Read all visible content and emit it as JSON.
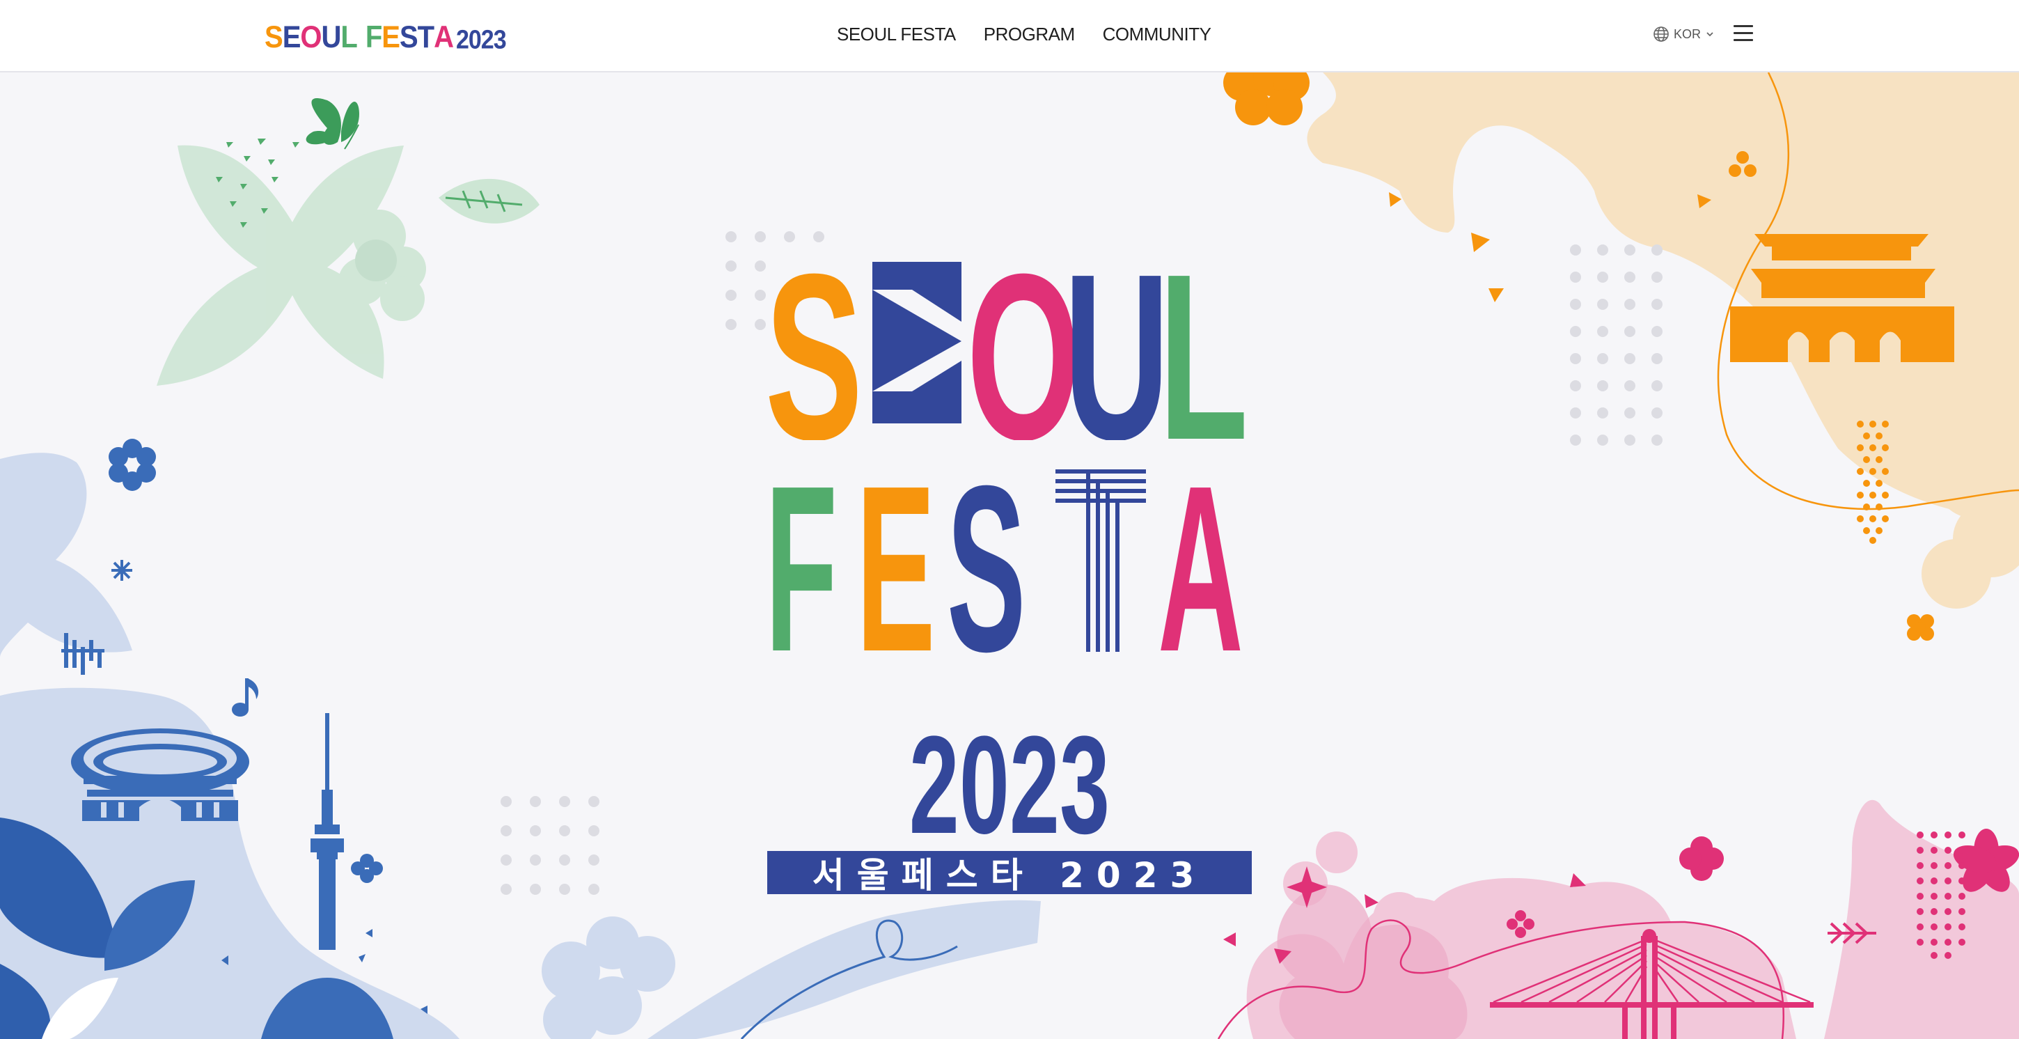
{
  "header": {
    "logo": {
      "word1": "SEOUL",
      "word2": "FESTA",
      "year": "2023"
    },
    "nav": [
      {
        "label": "SEOUL FESTA"
      },
      {
        "label": "PROGRAM"
      },
      {
        "label": "COMMUNITY"
      }
    ],
    "language": {
      "label": "KOR",
      "icon": "globe-icon",
      "caret": "chevron-down-icon"
    },
    "menu_icon": "hamburger-menu-icon"
  },
  "hero": {
    "title_line1": [
      "S",
      "E",
      "O",
      "U",
      "L"
    ],
    "title_line2": [
      "F",
      "E",
      "S",
      "T",
      "A"
    ],
    "year": "2023",
    "korean_title": "서울페스타 2023",
    "illustrations": [
      "stadium-icon",
      "seoul-tower-icon",
      "palace-gate-icon",
      "bridge-icon",
      "music-note-icon",
      "butterfly-icon"
    ]
  },
  "colors": {
    "orange": "#f7950d",
    "blue": "#33479a",
    "pink": "#e03177",
    "green": "#52ac6c",
    "light_blue": "#cfdaee",
    "light_orange": "#f7e2c2",
    "light_pink": "#f2c8da",
    "light_green": "#cde6d4"
  }
}
